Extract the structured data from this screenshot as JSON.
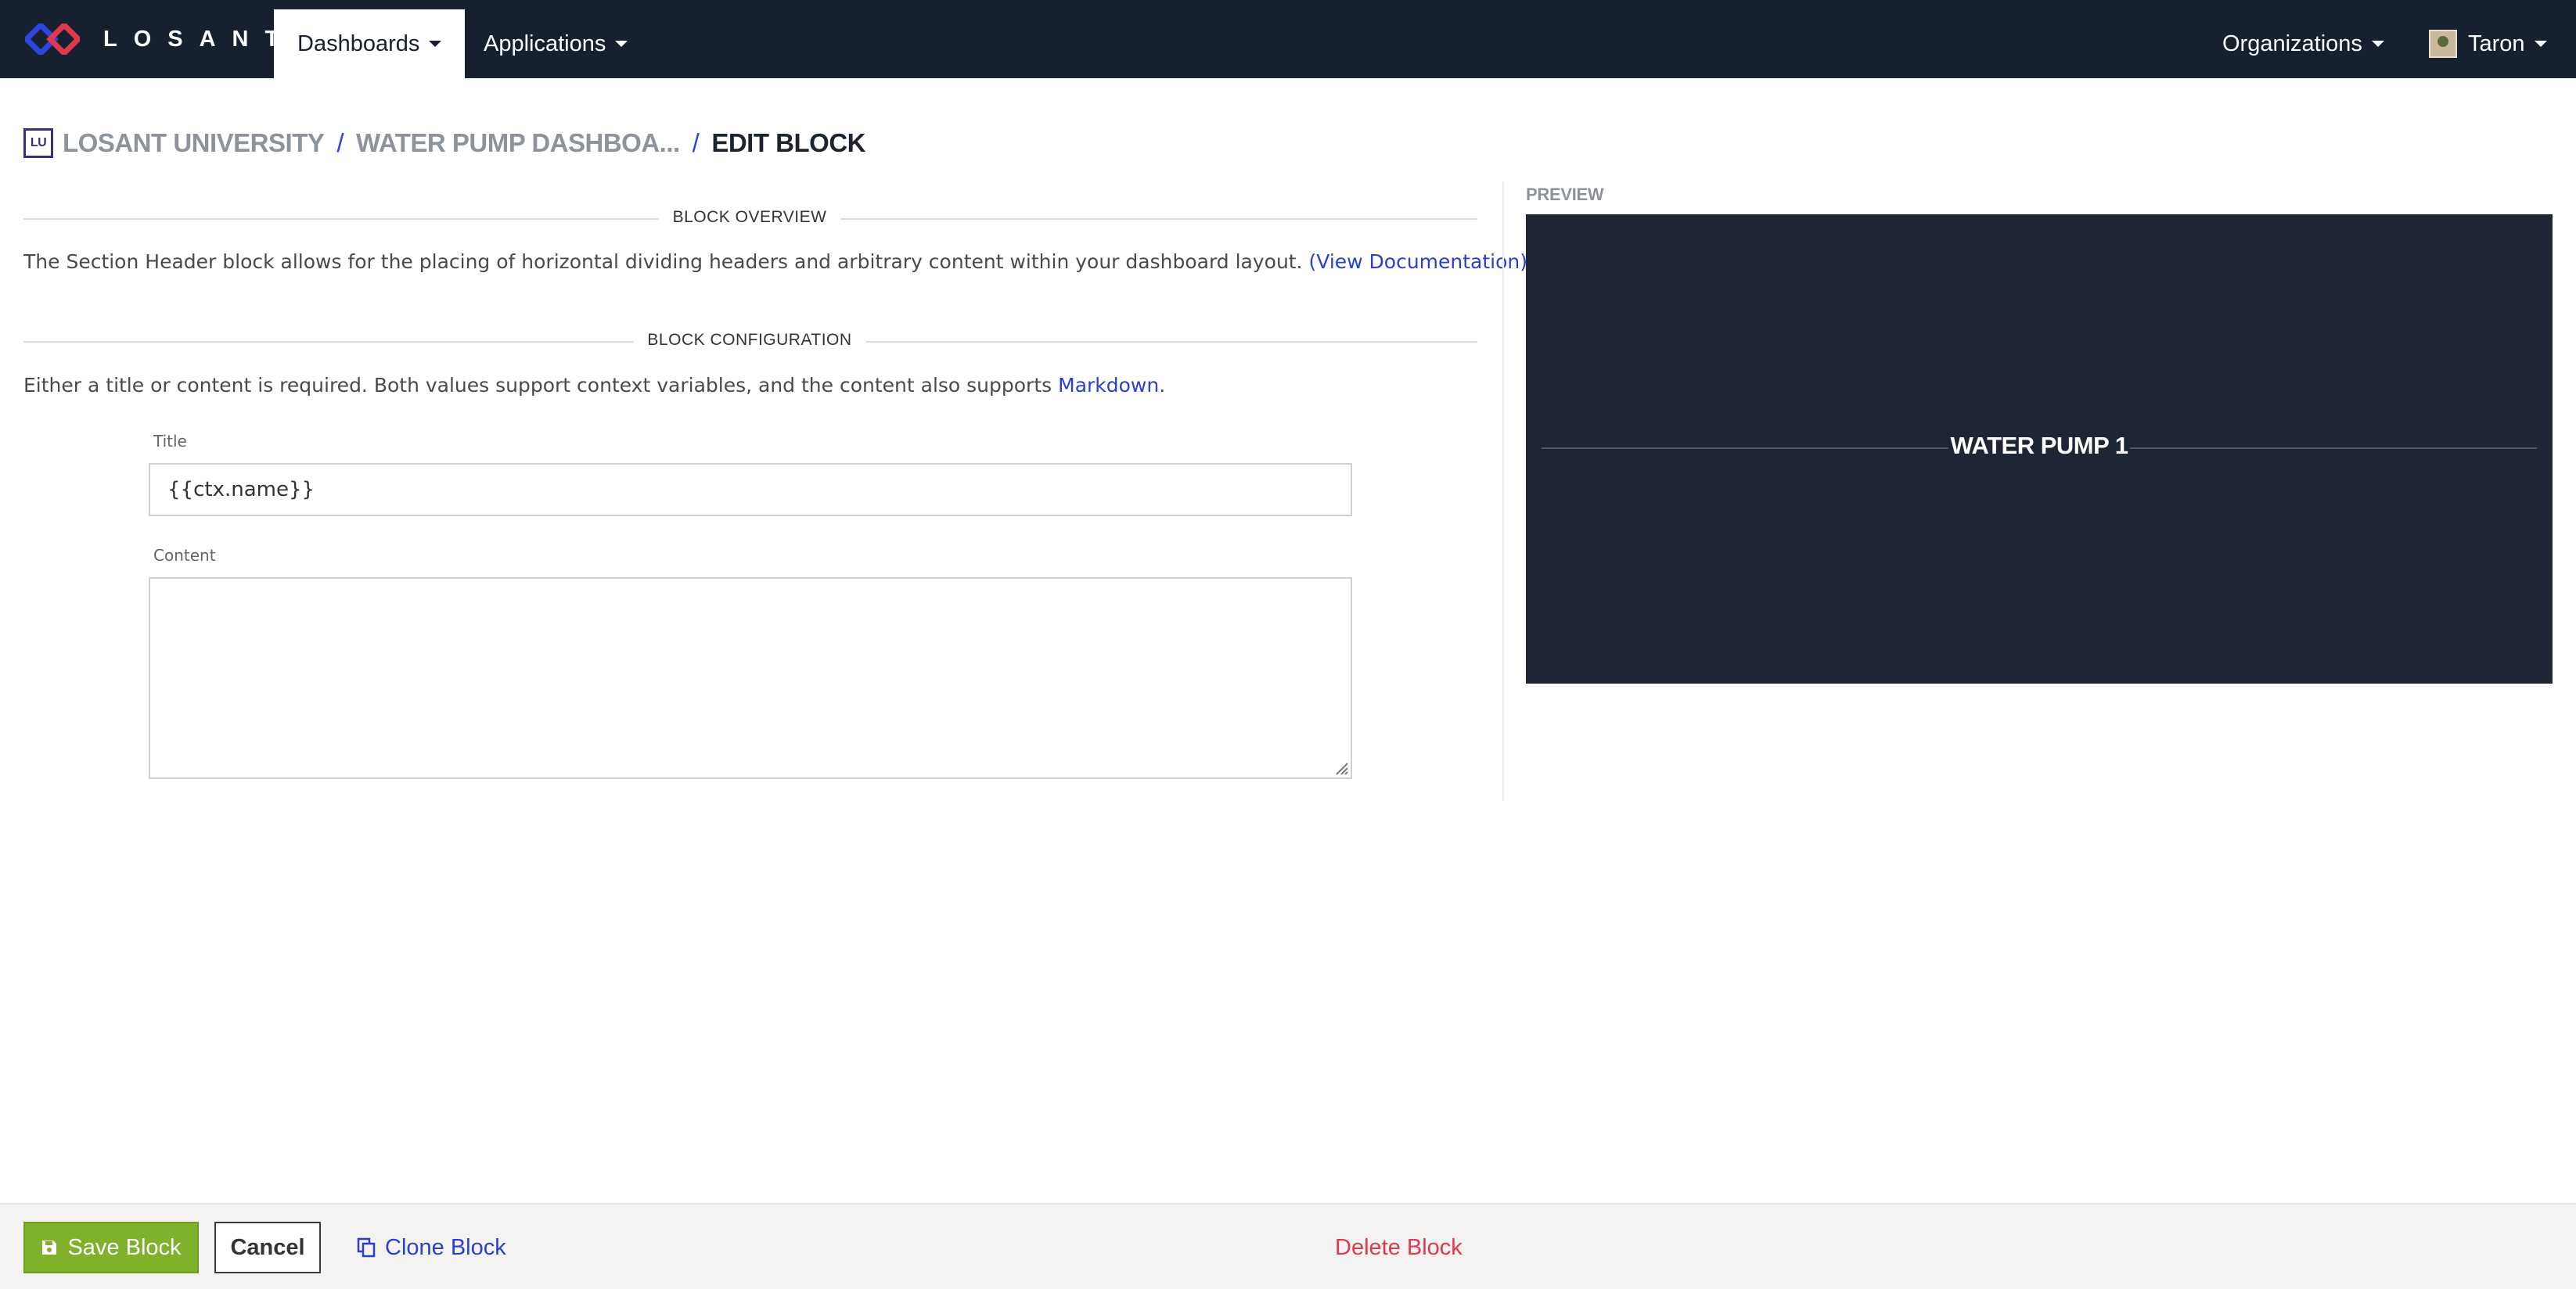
{
  "topnav": {
    "brand": "LOSANT",
    "dashboards_label": "Dashboards",
    "applications_label": "Applications",
    "organizations_label": "Organizations",
    "user_name": "Taron"
  },
  "breadcrumb": {
    "org_badge": "LU",
    "org_name": "LOSANT UNIVERSITY",
    "dashboard_name": "WATER PUMP DASHBOA...",
    "current": "EDIT BLOCK"
  },
  "overview": {
    "heading": "BLOCK OVERVIEW",
    "text": "The Section Header block allows for the placing of horizontal dividing headers and arbitrary content within your dashboard layout.",
    "doc_link": "(View Documentation)"
  },
  "configuration": {
    "heading": "BLOCK CONFIGURATION",
    "text": "Either a title or content is required. Both values support context variables, and the content also supports",
    "markdown_link": "Markdown",
    "text_end": "."
  },
  "form": {
    "title_label": "Title",
    "title_value": "{{ctx.name}}",
    "content_label": "Content",
    "content_value": ""
  },
  "preview": {
    "label": "PREVIEW",
    "header_text": "WATER PUMP 1"
  },
  "footer": {
    "save_label": "Save Block",
    "cancel_label": "Cancel",
    "clone_label": "Clone Block",
    "delete_label": "Delete Block"
  },
  "colors": {
    "nav_bg": "#16202e",
    "brand_blue": "#2a3fd1",
    "save_green": "#7fb12b",
    "delete_red": "#e0384f",
    "preview_bg": "#1e2636"
  }
}
